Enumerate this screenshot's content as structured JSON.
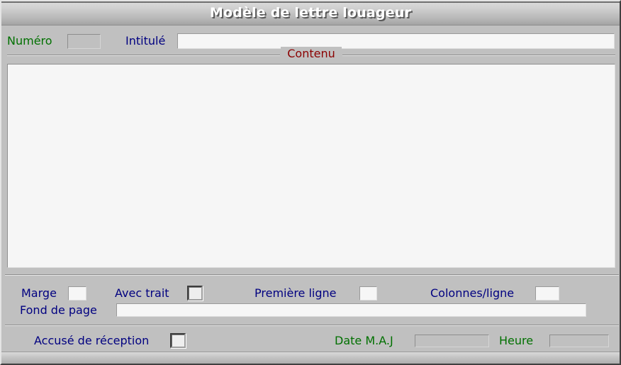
{
  "window": {
    "title": "Modèle de lettre louageur"
  },
  "header": {
    "numero_label": "Numéro",
    "numero_value": "",
    "intitule_label": "Intitulé",
    "intitule_value": "",
    "intitule_placeholder": ""
  },
  "content_group": {
    "legend": "Contenu",
    "value": "",
    "placeholder": ""
  },
  "options": {
    "marge_label": "Marge",
    "marge_value": "",
    "avec_trait_label": "Avec trait",
    "avec_trait_checked": false,
    "premiere_ligne_label": "Première ligne",
    "premiere_ligne_value": "",
    "colonnes_ligne_label": "Colonnes/ligne",
    "colonnes_ligne_value": "",
    "fond_de_page_label": "Fond de page",
    "fond_de_page_value": "",
    "fond_de_page_placeholder": ""
  },
  "status": {
    "accuse_reception_label": "Accusé de réception",
    "accuse_reception_checked": false,
    "date_maj_label": "Date M.A.J",
    "date_maj_value": "",
    "heure_label": "Heure",
    "heure_value": ""
  },
  "colors": {
    "window_face": "#c0c0c0",
    "label_green": "#007000",
    "label_blue": "#000080",
    "label_red": "#8b0000",
    "field_white": "#f6f6f6",
    "field_disabled": "#c0c0c0",
    "title_text": "#ffffff"
  }
}
